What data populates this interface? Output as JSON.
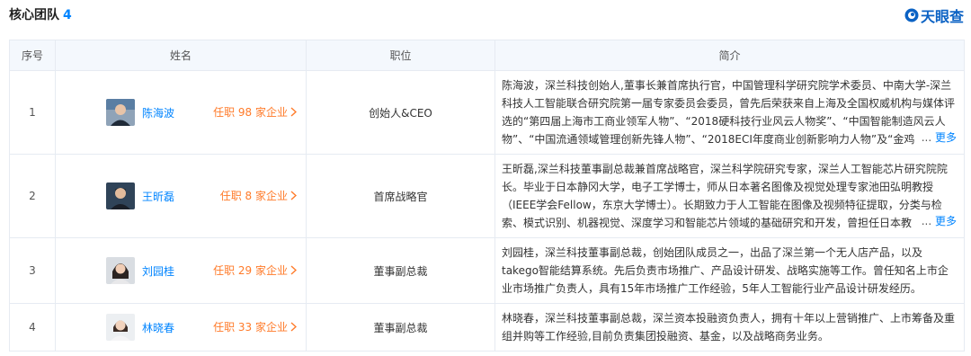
{
  "header": {
    "title": "核心团队",
    "count": "4",
    "brand": "天眼查"
  },
  "columns": [
    "序号",
    "姓名",
    "职位",
    "简介"
  ],
  "rows": [
    {
      "index": "1",
      "name": "陈海波",
      "tenure": "任职 98 家企业",
      "position": "创始人&CEO",
      "intro": "陈海波，深兰科技创始人,董事长兼首席执行官，中国管理科学研究院学术委员、中南大学-深兰科技人工智能联合研究院第一届专家委员会委员，曾先后荣获来自上海及全国权威机构与媒体评选的“第四届上海市工商业领军人物”、“2018硬科技行业风云人物奖”、“中国智能制造风云人物”、“中国流通领域管理创新先锋人物”、“2018ECI年度商业创新影响力人物”及“金鸡",
      "more_prefix": "...",
      "more": "更多"
    },
    {
      "index": "2",
      "name": "王昕磊",
      "tenure": "任职 8 家企业",
      "position": "首席战略官",
      "intro": "王昕磊,深兰科技董事副总裁兼首席战略官，深兰科学院研究专家，深兰人工智能芯片研究院院长。毕业于日本静冈大学，电子工学博士，师从日本著名图像及视觉处理专家池田弘明教授（IEEE学会Fellow，东京大学博士）。长期致力于人工智能在图像及视频特征提取，分类与检索、模式识别、机器视觉、深度学习和智能芯片领域的基础研究和开发，曾担任日本教",
      "more_prefix": "...",
      "more": "更多"
    },
    {
      "index": "3",
      "name": "刘园桂",
      "tenure": "任职 29 家企业",
      "position": "董事副总裁",
      "intro": "刘园桂，深兰科技董事副总裁，创始团队成员之一，出品了深兰第一个无人店产品，以及takego智能结算系统。先后负责市场推广、产品设计研发、战略实施等工作。曾任知名上市企业市场推广负责人，具有15年市场推广工作经验，5年人工智能行业产品设计研发经历。"
    },
    {
      "index": "4",
      "name": "林晓春",
      "tenure": "任职 33 家企业",
      "position": "董事副总裁",
      "intro": "林晓春，深兰科技董事副总裁，深兰资本投融资负责人，拥有十年以上营销推广、上市筹备及重组并购等工作经验,目前负责集团投融资、基金，以及战略商务业务。"
    }
  ]
}
